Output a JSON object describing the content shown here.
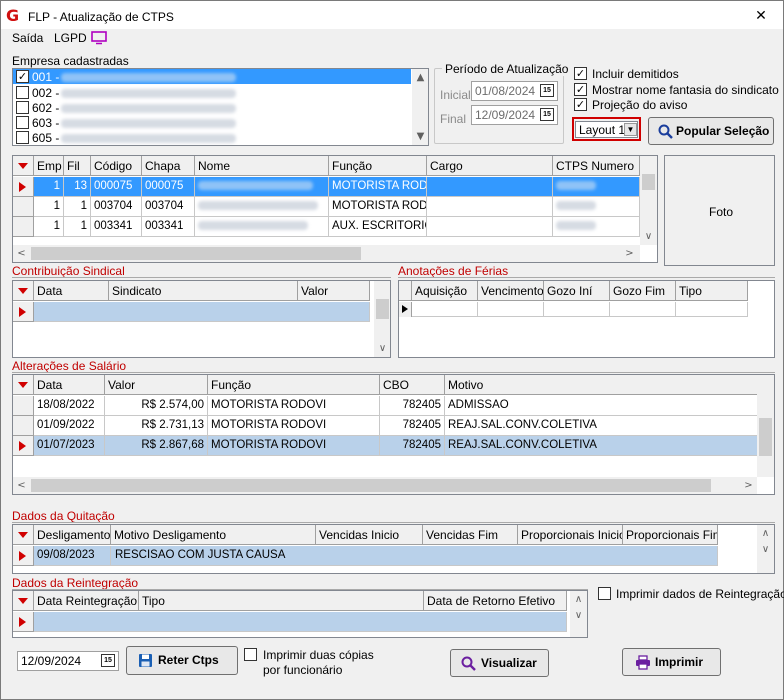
{
  "window": {
    "title": "FLP - Atualização de CTPS",
    "close": "✕"
  },
  "menu": {
    "saida": "Saída",
    "lgpd": "LGPD"
  },
  "empresas": {
    "label": "Empresa cadastradas",
    "items": [
      {
        "code": "001 -",
        "checked": true
      },
      {
        "code": "002 -",
        "checked": false
      },
      {
        "code": "602 -",
        "checked": false
      },
      {
        "code": "603 -",
        "checked": false
      },
      {
        "code": "605 -",
        "checked": false
      }
    ]
  },
  "periodo": {
    "label": "Período de Atualização",
    "inicial_label": "Inicial",
    "inicial": "01/08/2024",
    "final_label": "Final",
    "final": "12/09/2024"
  },
  "options": {
    "incluir_demitidos": "Incluir demitidos",
    "mostrar_fantasia": "Mostrar nome fantasia do sindicato",
    "projecao_aviso": "Projeção do aviso"
  },
  "layout_select": "Layout 1",
  "popular_button": "Popular Seleção",
  "foto": "Foto",
  "employees": {
    "headers": [
      "Emp",
      "Fil",
      "Código",
      "Chapa",
      "Nome",
      "Função",
      "Cargo",
      "CTPS Numero"
    ],
    "rows": [
      {
        "emp": "1",
        "fil": "13",
        "codigo": "000075",
        "chapa": "000075",
        "funcao": "MOTORISTA ROD..."
      },
      {
        "emp": "1",
        "fil": "1",
        "codigo": "003704",
        "chapa": "003704",
        "funcao": "MOTORISTA ROD..."
      },
      {
        "emp": "1",
        "fil": "1",
        "codigo": "003341",
        "chapa": "003341",
        "funcao": "AUX. ESCRITORIO"
      }
    ]
  },
  "contribuicao": {
    "title": "Contribuição Sindical",
    "headers": [
      "Data",
      "Sindicato",
      "Valor"
    ]
  },
  "ferias": {
    "title": "Anotações de Férias",
    "headers": [
      "Aquisição",
      "Vencimento",
      "Gozo Iní",
      "Gozo Fim",
      "Tipo"
    ]
  },
  "salario": {
    "title": "Alterações de Salário",
    "headers": [
      "Data",
      "Valor",
      "Função",
      "CBO",
      "Motivo"
    ],
    "rows": [
      {
        "data": "18/08/2022",
        "valor": "R$ 2.574,00",
        "funcao": "MOTORISTA RODOVI",
        "cbo": "782405",
        "motivo": "ADMISSAO"
      },
      {
        "data": "01/09/2022",
        "valor": "R$ 2.731,13",
        "funcao": "MOTORISTA RODOVI",
        "cbo": "782405",
        "motivo": "REAJ.SAL.CONV.COLETIVA"
      },
      {
        "data": "01/07/2023",
        "valor": "R$ 2.867,68",
        "funcao": "MOTORISTA RODOVI",
        "cbo": "782405",
        "motivo": "REAJ.SAL.CONV.COLETIVA"
      }
    ]
  },
  "quitacao": {
    "title": "Dados da Quitação",
    "headers": [
      "Desligamento",
      "Motivo Desligamento",
      "Vencidas Inicio",
      "Vencidas Fim",
      "Proporcionais Inicio",
      "Proporcionais Fim"
    ],
    "row": {
      "desligamento": "09/08/2023",
      "motivo": "RESCISAO COM JUSTA CAUSA"
    }
  },
  "reintegracao": {
    "title": "Dados da Reintegração",
    "headers": [
      "Data Reintegração",
      "Tipo",
      "Data de Retorno Efetivo"
    ],
    "imprimir": "Imprimir dados de Reintegração"
  },
  "footer": {
    "date": "12/09/2024",
    "reter": "Reter Ctps",
    "duas_copias_1": "Imprimir duas cópias",
    "duas_copias_2": "por funcionário",
    "visualizar": "Visualizar",
    "imprimir": "Imprimir"
  },
  "colors": {
    "accent_red": "#c00000",
    "selection": "#3399ff",
    "row_highlight": "#b9d1ea"
  }
}
